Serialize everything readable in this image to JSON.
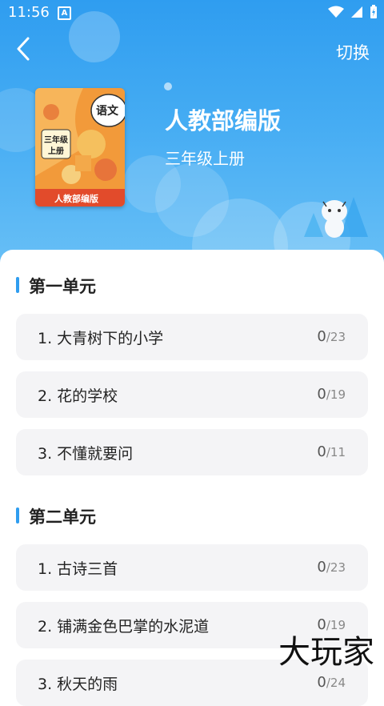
{
  "status_bar": {
    "time": "11:56",
    "notification": "A"
  },
  "nav": {
    "switch_label": "切换"
  },
  "book": {
    "title": "人教部编版",
    "grade": "三年级上册",
    "cover_subject": "语文",
    "cover_grade_line1": "三年级",
    "cover_grade_line2": "上册",
    "cover_publisher": "人教部编版"
  },
  "units": [
    {
      "title": "第一单元",
      "lessons": [
        {
          "name": "1. 大青树下的小学",
          "done": "0",
          "total": "/23"
        },
        {
          "name": "2. 花的学校",
          "done": "0",
          "total": "/19"
        },
        {
          "name": "3. 不懂就要问",
          "done": "0",
          "total": "/11"
        }
      ]
    },
    {
      "title": "第二单元",
      "lessons": [
        {
          "name": "1. 古诗三首",
          "done": "0",
          "total": "/23"
        },
        {
          "name": "2. 铺满金色巴掌的水泥道",
          "done": "0",
          "total": "/19"
        },
        {
          "name": "3. 秋天的雨",
          "done": "0",
          "total": "/24"
        }
      ]
    }
  ],
  "watermark": "大玩家",
  "colors": {
    "accent": "#2f9df0",
    "card_bg": "#f4f4f6",
    "cover_orange": "#f39a3b"
  }
}
